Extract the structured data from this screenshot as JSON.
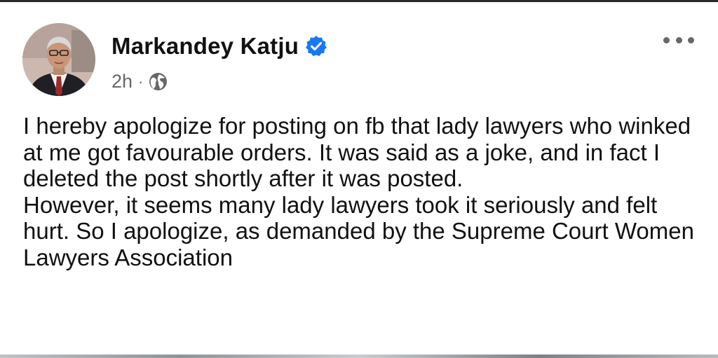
{
  "post": {
    "author_name": "Markandey Katju",
    "verified": true,
    "timestamp": "2h",
    "separator": "·",
    "audience_icon": "globe-icon",
    "more_icon": "more-options-icon",
    "paragraphs": [
      "I hereby apologize for posting on fb that lady lawyers who winked at me got favourable orders. It was said as a joke, and in fact I deleted the post shortly after it was posted.",
      "However, it seems many lady lawyers took it seriously and felt hurt. So I apologize, as demanded by the Supreme Court Women Lawyers Association"
    ]
  },
  "colors": {
    "verified_badge": "#1877f2",
    "secondary_text": "#65676b",
    "primary_text": "#111111"
  }
}
